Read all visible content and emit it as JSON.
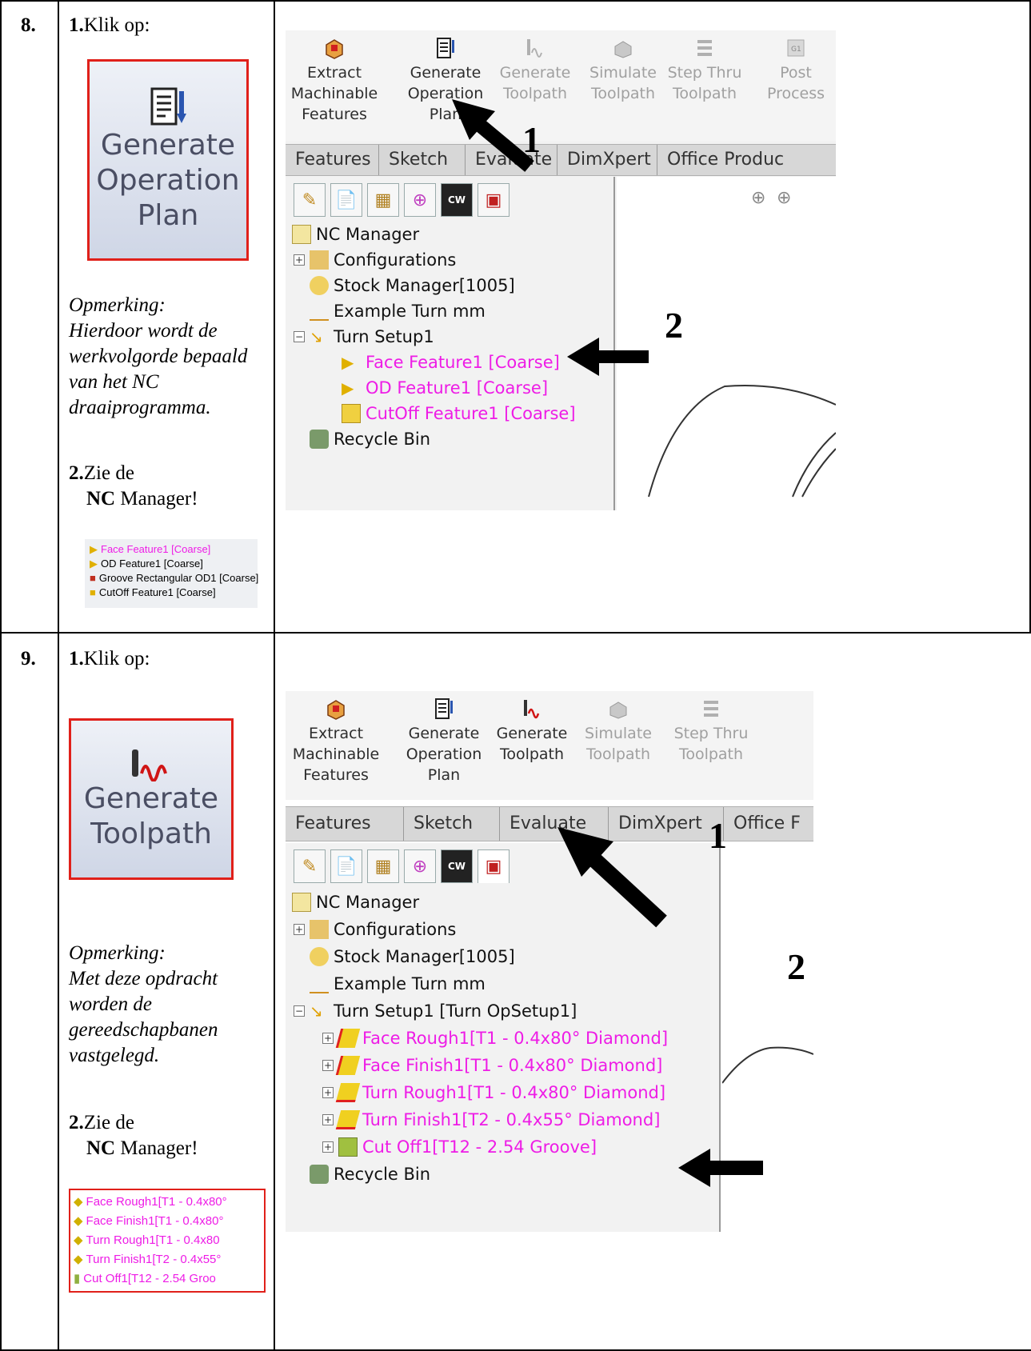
{
  "row8": {
    "step": "8.",
    "instr_num": "1.",
    "instr_text": "Klik op:",
    "button_label": "Generate Operation Plan",
    "note_title": "Opmerking:",
    "note_body": "Hierdoor wordt de werkvolgorde bepaald van het NC draaiprogramma.",
    "see_num": "2.",
    "see_text": "Zie de",
    "see_bold": "NC",
    "see_rest": "Manager!",
    "mini_items": [
      {
        "label": "Face Feature1 [Coarse]",
        "pink": true
      },
      {
        "label": "OD Feature1 [Coarse]",
        "pink": false
      },
      {
        "label": "Groove Rectangular OD1 [Coarse]",
        "pink": false
      },
      {
        "label": "CutOff Feature1 [Coarse]",
        "pink": false
      }
    ],
    "ribbon": [
      {
        "label": "Extract Machinable Features",
        "dim": false,
        "icon": "extract-features-icon"
      },
      {
        "label": "Generate Operation Plan",
        "dim": false,
        "icon": "operation-plan-icon"
      },
      {
        "label": "Generate Toolpath",
        "dim": true,
        "icon": "toolpath-icon"
      },
      {
        "label": "Simulate Toolpath",
        "dim": true,
        "icon": "simulate-icon"
      },
      {
        "label": "Step Thru Toolpath",
        "dim": true,
        "icon": "step-icon"
      },
      {
        "label": "Post Process",
        "dim": true,
        "icon": "post-process-icon"
      }
    ],
    "tabs": [
      "Features",
      "Sketch",
      "Evaluate",
      "DimXpert",
      "Office Produc"
    ],
    "tree": [
      {
        "label": "NC Manager",
        "pink": false,
        "indent": 0
      },
      {
        "label": "Configurations",
        "pink": false,
        "indent": 1
      },
      {
        "label": "Stock Manager[1005]",
        "pink": false,
        "indent": 1
      },
      {
        "label": "Example Turn mm",
        "pink": false,
        "indent": 1
      },
      {
        "label": "Turn Setup1",
        "pink": false,
        "indent": 1
      },
      {
        "label": "Face Feature1 [Coarse]",
        "pink": true,
        "indent": 2
      },
      {
        "label": "OD Feature1 [Coarse]",
        "pink": true,
        "indent": 2
      },
      {
        "label": "CutOff Feature1 [Coarse]",
        "pink": true,
        "indent": 2
      },
      {
        "label": "Recycle Bin",
        "pink": false,
        "indent": 1
      }
    ],
    "callout_1": "1",
    "callout_2": "2"
  },
  "row9": {
    "step": "9.",
    "instr_num": "1.",
    "instr_text": "Klik op:",
    "button_label": "Generate Toolpath",
    "note_title": "Opmerking:",
    "note_body": "Met deze opdracht worden de gereedschapbanen vastgelegd.",
    "see_num": "2.",
    "see_text": "Zie de",
    "see_bold": "NC",
    "see_rest": "Manager!",
    "mini_items": [
      "Face Rough1[T1 - 0.4x80°",
      "Face Finish1[T1 - 0.4x80°",
      "Turn Rough1[T1 - 0.4x80",
      "Turn Finish1[T2 - 0.4x55°",
      "Cut Off1[T12 - 2.54 Groo"
    ],
    "ribbon": [
      {
        "label": "Extract Machinable Features",
        "dim": false,
        "icon": "extract-features-icon"
      },
      {
        "label": "Generate Operation Plan",
        "dim": false,
        "icon": "operation-plan-icon"
      },
      {
        "label": "Generate Toolpath",
        "dim": false,
        "icon": "toolpath-icon"
      },
      {
        "label": "Simulate Toolpath",
        "dim": true,
        "icon": "simulate-icon"
      },
      {
        "label": "Step Thru Toolpath",
        "dim": true,
        "icon": "step-icon"
      }
    ],
    "tabs": [
      "Features",
      "Sketch",
      "Evaluate",
      "DimXpert",
      "Office F"
    ],
    "tree": [
      {
        "label": "NC Manager",
        "pink": false,
        "indent": 0
      },
      {
        "label": "Configurations",
        "pink": false,
        "indent": 1
      },
      {
        "label": "Stock Manager[1005]",
        "pink": false,
        "indent": 1
      },
      {
        "label": "Example Turn mm",
        "pink": false,
        "indent": 1
      },
      {
        "label": "Turn Setup1 [Turn OpSetup1]",
        "pink": false,
        "indent": 1
      },
      {
        "label": "Face Rough1[T1 - 0.4x80° Diamond]",
        "pink": true,
        "indent": 2
      },
      {
        "label": "Face Finish1[T1 - 0.4x80° Diamond]",
        "pink": true,
        "indent": 2
      },
      {
        "label": "Turn Rough1[T1 - 0.4x80° Diamond]",
        "pink": true,
        "indent": 2
      },
      {
        "label": "Turn Finish1[T2 - 0.4x55° Diamond]",
        "pink": true,
        "indent": 2
      },
      {
        "label": "Cut Off1[T12 - 2.54 Groove]",
        "pink": true,
        "indent": 2
      },
      {
        "label": "Recycle Bin",
        "pink": false,
        "indent": 1
      }
    ],
    "callout_1": "1",
    "callout_2": "2"
  },
  "colors": {
    "accent_red": "#e0201a",
    "tree_pink": "#ee1ce6"
  }
}
